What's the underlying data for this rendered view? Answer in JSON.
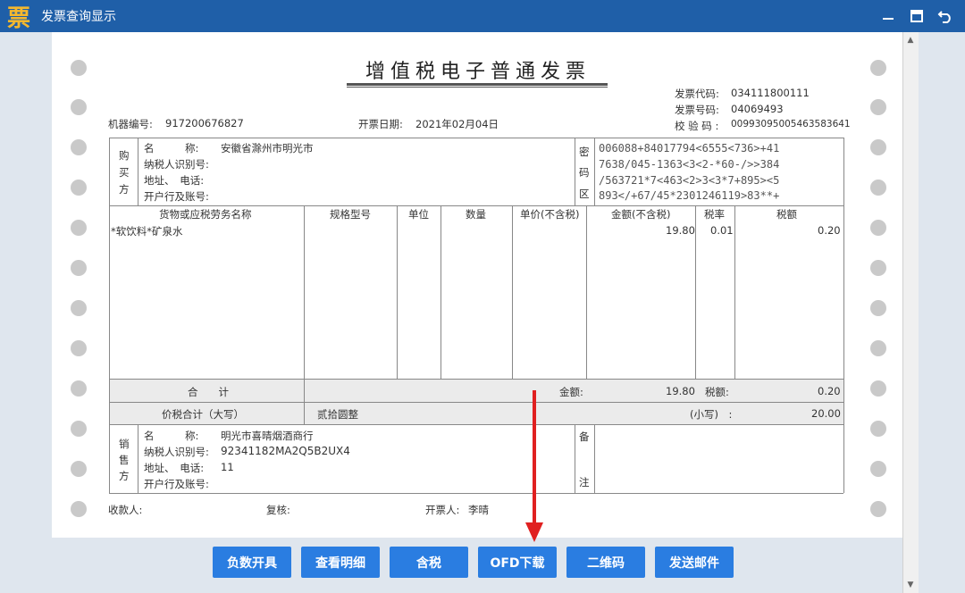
{
  "window": {
    "title": "发票查询显示",
    "app_icon_char": "票"
  },
  "invoice": {
    "title": "增值税电子普通发票",
    "machine_no_label": "机器编号:",
    "machine_no": "917200676827",
    "issue_date_label": "开票日期:",
    "issue_date": "2021年02月04日",
    "code_label": "发票代码:",
    "code": "034111800111",
    "number_label": "发票号码:",
    "number": "04069493",
    "check_label": "校 验 码 :",
    "check_code": "00993095005463583641",
    "buyer": {
      "side_label": [
        "购",
        "买",
        "方"
      ],
      "name_label": "名　　　称:",
      "name": "安徽省滁州市明光市",
      "tax_id_label": "纳税人识别号:",
      "tax_id": "",
      "address_label": "地址、　电话:",
      "address": "",
      "bank_label": "开户行及账号:",
      "bank": ""
    },
    "cipher": {
      "side_label": [
        "密",
        "码",
        "区"
      ],
      "lines": [
        "006088+84017794<6555<736>+41",
        "7638/045-1363<3<2-*60-/>>384",
        "/563721*7<463<2>3<3*7+895><5",
        "893</+67/45*2301246119>83**+"
      ]
    },
    "columns": [
      "货物或应税劳务名称",
      "规格型号",
      "单位",
      "数量",
      "单价(不含税)",
      "金额(不含税)",
      "税率",
      "税额"
    ],
    "items": [
      {
        "name": "*软饮料*矿泉水",
        "spec": "",
        "unit": "",
        "qty": "",
        "price": "",
        "amount": "19.80",
        "rate": "0.01",
        "tax": "0.20"
      }
    ],
    "total_label": "合　　计",
    "total_amount_label": "金额:",
    "total_amount": "19.80",
    "total_tax_label": "税额:",
    "total_tax": "0.20",
    "grand_total_label": "价税合计（大写）",
    "grand_total_words": "贰拾圆整",
    "grand_total_small_label": "(小写)　:",
    "grand_total": "20.00",
    "seller": {
      "side_label": [
        "销",
        "售",
        "方"
      ],
      "name_label": "名　　　称:",
      "name": "明光市喜晴烟酒商行",
      "tax_id_label": "纳税人识别号:",
      "tax_id": "92341182MA2Q5B2UX4",
      "address_label": "地址、　电话:",
      "address": "11",
      "bank_label": "开户行及账号:",
      "bank": ""
    },
    "remark_label": [
      "备",
      "注"
    ],
    "payee_label": "收款人:",
    "reviewer_label": "复核:",
    "drawer_label": "开票人:",
    "drawer": "李晴"
  },
  "buttons": [
    "负数开具",
    "查看明细",
    "含税",
    "OFD下载",
    "二维码",
    "发送邮件"
  ],
  "colors": {
    "titlebar": "#1f5fa8",
    "button": "#2a7de1",
    "annotation_arrow": "#e02020"
  }
}
